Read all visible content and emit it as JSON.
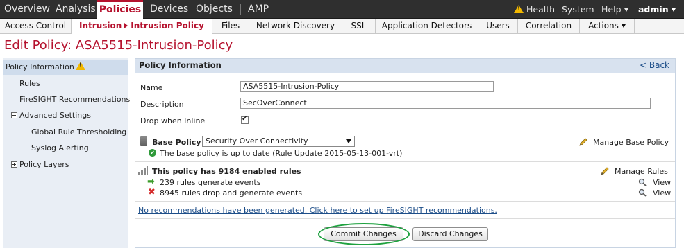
{
  "topnav": {
    "items": [
      "Overview",
      "Analysis",
      "Policies",
      "Devices",
      "Objects",
      "AMP"
    ],
    "active": "Policies",
    "right": {
      "health": "Health",
      "system": "System",
      "help": "Help",
      "user": "admin"
    }
  },
  "subnav": {
    "tabs": [
      "Access Control",
      "Intrusion",
      "Intrusion Policy",
      "Files",
      "Network Discovery",
      "SSL",
      "Application Detectors",
      "Users",
      "Correlation",
      "Actions"
    ]
  },
  "page_title": "Edit Policy: ASA5515-Intrusion-Policy",
  "sidebar": {
    "items": [
      "Policy Information",
      "Rules",
      "FireSIGHT Recommendations",
      "Advanced Settings",
      "Global Rule Thresholding",
      "Syslog Alerting",
      "Policy Layers"
    ]
  },
  "panel": {
    "title": "Policy Information",
    "back": "< Back",
    "name_label": "Name",
    "name_value": "ASA5515-Intrusion-Policy",
    "description_label": "Description",
    "description_value": "SecOverConnect",
    "drop_inline_label": "Drop when Inline",
    "drop_inline_checked": true,
    "base_policy_label": "Base Policy",
    "base_policy_value": "Security Over Connectivity",
    "base_policy_status": "The base policy is up to date (Rule Update 2015-05-13-001-vrt)",
    "manage_base_policy": "Manage Base Policy",
    "rules_summary": "This policy has 9184 enabled rules",
    "manage_rules": "Manage Rules",
    "rules_generate": "239 rules generate events",
    "rules_drop": "8945 rules drop and generate events",
    "view": "View",
    "recommendations_link": "No recommendations have been generated. Click here to set up FireSIGHT recommendations.",
    "commit": "Commit Changes",
    "discard": "Discard Changes"
  },
  "colors": {
    "brand": "#b5122e",
    "link": "#1d4e89",
    "highlight": "#1ea13f"
  }
}
